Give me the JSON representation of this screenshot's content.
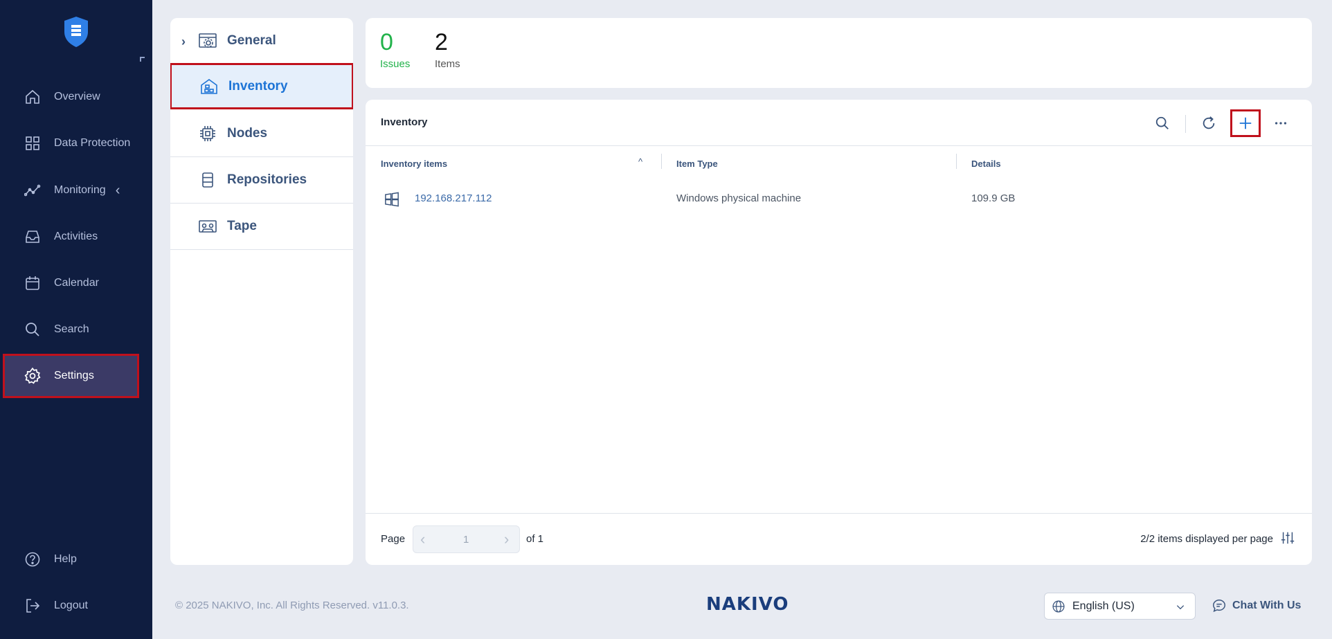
{
  "sidebar": {
    "items": [
      {
        "label": "Overview",
        "icon": "home-icon"
      },
      {
        "label": "Data Protection",
        "icon": "grid-icon"
      },
      {
        "label": "Monitoring",
        "icon": "chart-line-icon"
      },
      {
        "label": "Activities",
        "icon": "inbox-icon"
      },
      {
        "label": "Calendar",
        "icon": "calendar-icon"
      },
      {
        "label": "Search",
        "icon": "search-icon"
      },
      {
        "label": "Settings",
        "icon": "gear-icon"
      }
    ],
    "bottom": [
      {
        "label": "Help",
        "icon": "help-icon"
      },
      {
        "label": "Logout",
        "icon": "logout-icon"
      }
    ]
  },
  "settings_menu": {
    "items": [
      {
        "label": "General"
      },
      {
        "label": "Inventory"
      },
      {
        "label": "Nodes"
      },
      {
        "label": "Repositories"
      },
      {
        "label": "Tape"
      }
    ]
  },
  "summary": {
    "issues_count": "0",
    "issues_label": "Issues",
    "items_count": "2",
    "items_label": "Items"
  },
  "inventory": {
    "title": "Inventory",
    "columns": [
      "Inventory items",
      "Item Type",
      "Details"
    ],
    "rows": [
      {
        "name": "192.168.217.112",
        "type": "Windows physical machine",
        "details": "109.9 GB"
      }
    ],
    "pagination": {
      "page_label": "Page",
      "current_page": "1",
      "of_label": "of 1",
      "per_page_text": "2/2 items displayed per page"
    }
  },
  "footer": {
    "copyright": "© 2025 NAKIVO, Inc. All Rights Reserved. v11.0.3.",
    "brand": "NAKIVO",
    "language": "English (US)",
    "chat_label": "Chat With Us"
  },
  "colors": {
    "sidebar_bg": "#0f1d40",
    "accent": "#1d74d6",
    "highlight_border": "#c0101c",
    "issues_green": "#21b24a"
  }
}
